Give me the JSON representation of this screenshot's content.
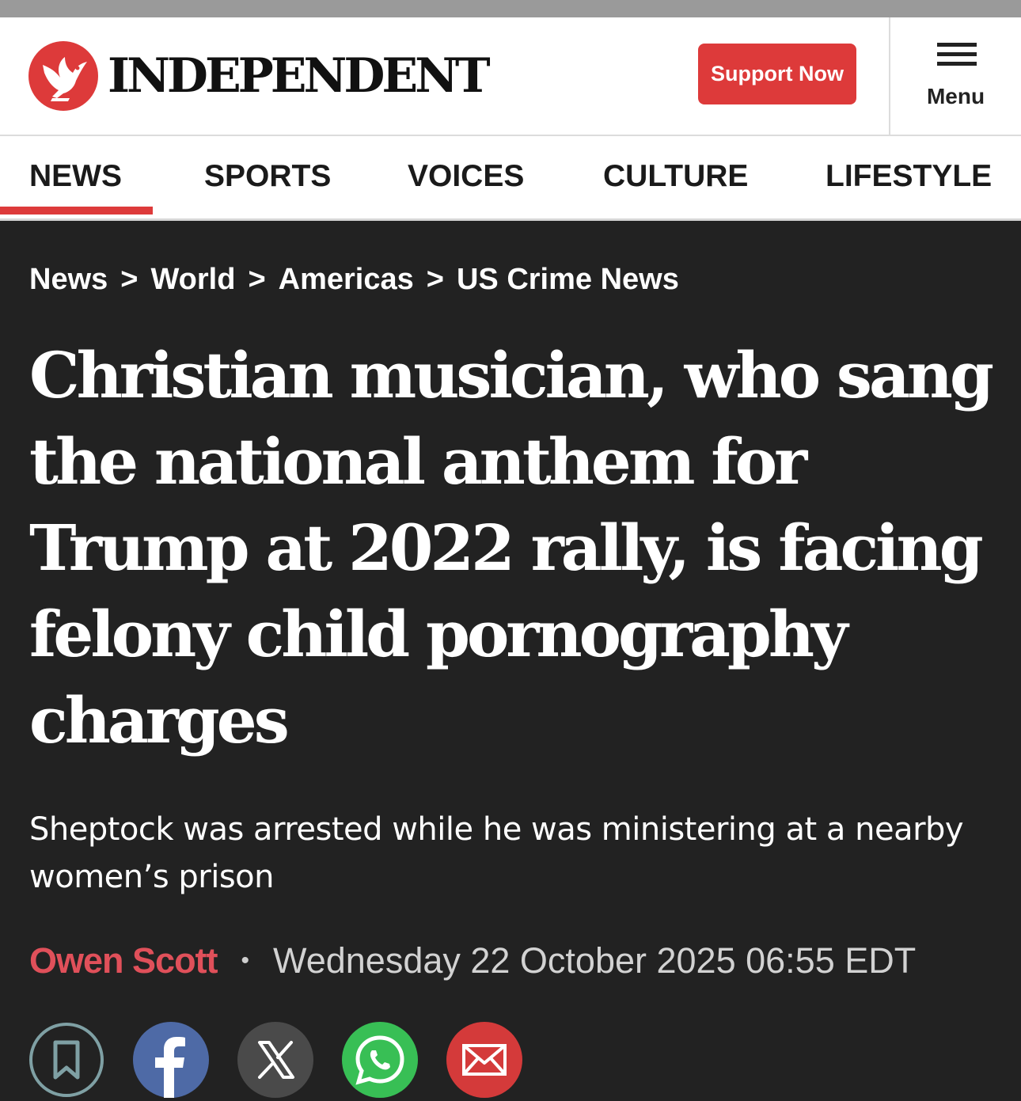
{
  "header": {
    "brand": "INDEPENDENT",
    "support_label": "Support Now",
    "menu_label": "Menu"
  },
  "nav": {
    "tabs": [
      {
        "label": "NEWS",
        "active": true
      },
      {
        "label": "SPORTS"
      },
      {
        "label": "VOICES"
      },
      {
        "label": "CULTURE"
      },
      {
        "label": "LIFESTYLE"
      }
    ]
  },
  "article": {
    "breadcrumbs": [
      "News",
      "World",
      "Americas",
      "US Crime News"
    ],
    "breadcrumb_separator": ">",
    "headline": "Christian musician, who sang the national anthem for Trump at 2022 rally, is facing felony child pornography charges",
    "standfirst": "Sheptock was arrested while he was ministering at a nearby women’s prison",
    "author": "Owen Scott",
    "byline_dot": "•",
    "date": "Wednesday 22 October 2025 06:55 EDT"
  },
  "share": [
    {
      "icon": "bookmark-icon",
      "color": "#222222"
    },
    {
      "icon": "facebook-icon",
      "color": "#4e6aa6"
    },
    {
      "icon": "x-icon",
      "color": "#4a4a4a"
    },
    {
      "icon": "whatsapp-icon",
      "color": "#38bf55"
    },
    {
      "icon": "email-icon",
      "color": "#d43a3a"
    }
  ],
  "colors": {
    "accent": "#dd3a3a",
    "background": "#222222",
    "author": "#e0505a"
  }
}
